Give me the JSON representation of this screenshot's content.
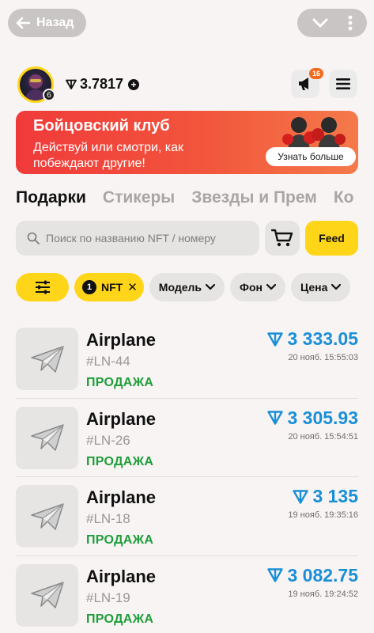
{
  "topbar": {
    "back_label": "Назад"
  },
  "header": {
    "balance": "3.7817",
    "avatar_level": "6",
    "notification_count": "16"
  },
  "banner": {
    "title": "Бойцовский клуб",
    "text": "Действуй или смотри, как побеждают другие!",
    "button": "Узнать больше"
  },
  "tabs": [
    {
      "label": "Подарки"
    },
    {
      "label": "Стикеры"
    },
    {
      "label": "Звезды и Прем"
    },
    {
      "label": "Ко"
    }
  ],
  "search": {
    "placeholder": "Поиск по названию NFT / номеру"
  },
  "feed_button": "Feed",
  "filters": {
    "active_count": "1",
    "active_label": "NFT",
    "chips": [
      {
        "label": "Модель"
      },
      {
        "label": "Фон"
      },
      {
        "label": "Цена"
      }
    ]
  },
  "items": [
    {
      "name": "Airplane",
      "code": "#LN-44",
      "status": "ПРОДАЖА",
      "price": "3 333.05",
      "date": "20 нояб. 15:55:03"
    },
    {
      "name": "Airplane",
      "code": "#LN-26",
      "status": "ПРОДАЖА",
      "price": "3 305.93",
      "date": "20 нояб. 15:54:51"
    },
    {
      "name": "Airplane",
      "code": "#LN-18",
      "status": "ПРОДАЖА",
      "price": "3 135",
      "date": "19 нояб. 19:35:16"
    },
    {
      "name": "Airplane",
      "code": "#LN-19",
      "status": "ПРОДАЖА",
      "price": "3 082.75",
      "date": "19 нояб. 19:24:52"
    }
  ],
  "colors": {
    "accent": "#ffd51a",
    "banner": "#f03a3a",
    "price": "#1a8fd6",
    "status": "#1f9d3a",
    "badge": "#f26b1d"
  }
}
